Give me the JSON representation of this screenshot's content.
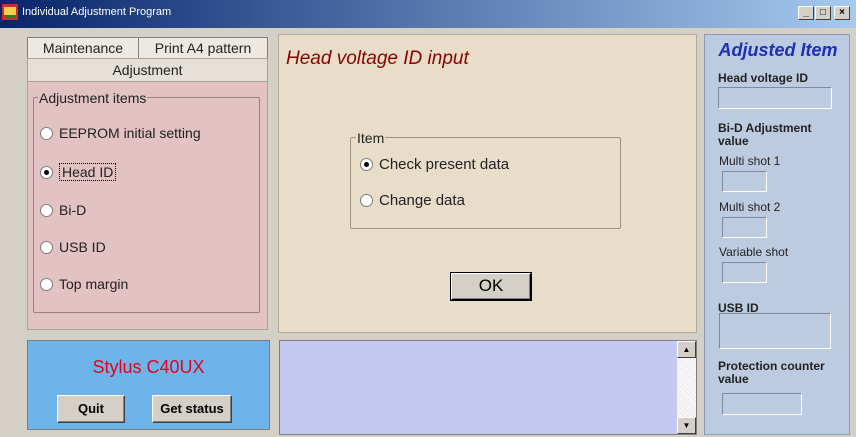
{
  "window": {
    "title": "Individual Adjustment Program",
    "minimize_glyph": "_",
    "maximize_glyph": "□",
    "close_glyph": "×"
  },
  "tabs": {
    "maintenance": "Maintenance",
    "print_a4": "Print A4 pattern",
    "adjustment": "Adjustment"
  },
  "adjustment_items": {
    "legend": "Adjustment items",
    "options": [
      {
        "label": "EEPROM initial setting",
        "checked": false
      },
      {
        "label": "Head ID",
        "checked": true
      },
      {
        "label": "Bi-D",
        "checked": false
      },
      {
        "label": "USB ID",
        "checked": false
      },
      {
        "label": "Top margin",
        "checked": false
      }
    ]
  },
  "device": {
    "model": "Stylus C40UX",
    "quit_label": "Quit",
    "get_status_label": "Get status"
  },
  "main": {
    "title": "Head voltage ID input",
    "item_legend": "Item",
    "options": [
      {
        "label": "Check present data",
        "checked": true
      },
      {
        "label": "Change data",
        "checked": false
      }
    ],
    "ok_label": "OK"
  },
  "output": {
    "text": "",
    "scroll_up_glyph": "▲",
    "scroll_down_glyph": "▼"
  },
  "adjusted": {
    "title": "Adjusted Item",
    "head_voltage_id": "Head voltage ID",
    "bid_label": "Bi-D Adjustment value",
    "multi_shot_1": "Multi shot 1",
    "multi_shot_2": "Multi shot 2",
    "variable_shot": "Variable shot",
    "usb_id": "USB ID",
    "protection_counter": "Protection counter value"
  },
  "colors": {
    "title_bar": "#08246b",
    "adjustment_bg": "#e2c2c2",
    "stylus_bg": "#6cb4ea",
    "stylus_text": "#e8001c",
    "center_bg": "#e8ddc9",
    "center_title": "#8c0000",
    "output_bg": "#c4c9f2",
    "right_bg": "#bccbe0",
    "right_title": "#1f2fb5"
  }
}
